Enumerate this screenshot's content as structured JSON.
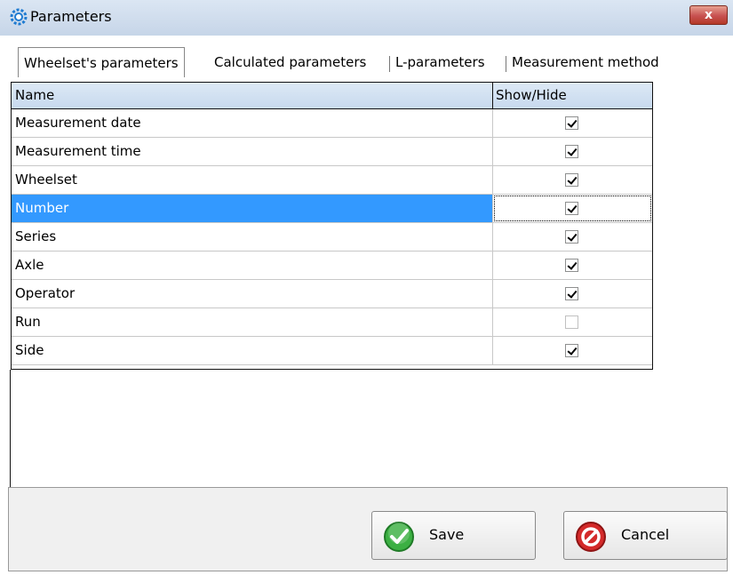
{
  "window": {
    "title": "Parameters",
    "close_glyph": "x",
    "icon": "gear-icon"
  },
  "tabs": [
    {
      "label": "Wheelset's parameters",
      "active": true
    },
    {
      "label": "Calculated parameters",
      "active": false
    },
    {
      "label": "L-parameters",
      "active": false
    },
    {
      "label": "Measurement method",
      "active": false
    }
  ],
  "grid": {
    "columns": {
      "name": "Name",
      "show": "Show/Hide"
    },
    "rows": [
      {
        "name": "Measurement date",
        "checked": true
      },
      {
        "name": "Measurement time",
        "checked": true
      },
      {
        "name": "Wheelset",
        "checked": true
      },
      {
        "name": "Number",
        "checked": true,
        "selected": true
      },
      {
        "name": "Series",
        "checked": true
      },
      {
        "name": "Axle",
        "checked": true
      },
      {
        "name": "Operator",
        "checked": true
      },
      {
        "name": "Run",
        "checked": false
      },
      {
        "name": "Side",
        "checked": true
      }
    ]
  },
  "buttons": {
    "save": "Save",
    "cancel": "Cancel"
  },
  "colors": {
    "selection": "#3399ff",
    "save_icon": "#2fa52f",
    "cancel_icon": "#d42a2a"
  }
}
